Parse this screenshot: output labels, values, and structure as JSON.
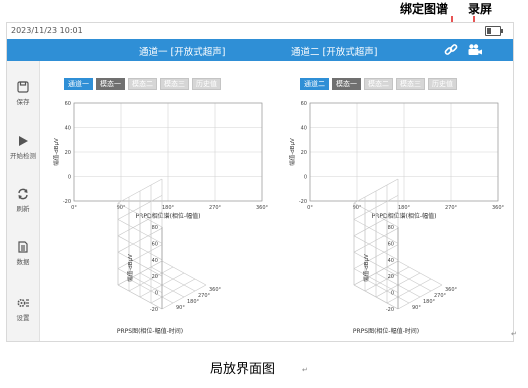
{
  "annotations": {
    "bind_label": "绑定图谱",
    "record_label": "录屏"
  },
  "status": {
    "time": "2023/11/23 10:01"
  },
  "header": {
    "channel1": "通道一 [开放式超声]",
    "channel2": "通道二 [开放式超声]"
  },
  "icons": {
    "bind": "link-icon",
    "record": "camera-icon"
  },
  "sidebar": {
    "items": [
      {
        "label": "保存",
        "icon": "save-icon"
      },
      {
        "label": "开始检测",
        "icon": "play-icon"
      },
      {
        "label": "刷新",
        "icon": "refresh-icon"
      },
      {
        "label": "数据",
        "icon": "data-icon"
      },
      {
        "label": "设置",
        "icon": "settings-icon"
      }
    ]
  },
  "panels": [
    {
      "tabs": [
        "通道一",
        "模态一",
        "模态二",
        "模态三",
        "历史值"
      ],
      "prpd": {
        "ylabel": "幅值-dBμV",
        "xlabel": "PRPD相位谱(相位-幅值)",
        "yticks": [
          "60",
          "40",
          "20",
          "0",
          "-20"
        ],
        "xticks": [
          "0°",
          "90°",
          "180°",
          "270°",
          "360°"
        ]
      },
      "prps": {
        "ylabel": "幅值-dBμV",
        "xlabel": "PRPS图(相位-幅值-时间)",
        "zticks": [
          "80",
          "60",
          "40",
          "20",
          "0",
          "-20"
        ],
        "phase_ticks": [
          "90°",
          "180°",
          "270°",
          "360°"
        ]
      }
    },
    {
      "tabs": [
        "通道二",
        "模态一",
        "模态二",
        "模态三",
        "历史值"
      ],
      "prpd": {
        "ylabel": "幅值-dBμV",
        "xlabel": "PRPD相位谱(相位-幅值)",
        "yticks": [
          "60",
          "40",
          "20",
          "0",
          "-20"
        ],
        "xticks": [
          "0°",
          "90°",
          "180°",
          "270°",
          "360°"
        ]
      },
      "prps": {
        "ylabel": "幅值-dBμV",
        "xlabel": "PRPS图(相位-幅值-时间)",
        "zticks": [
          "80",
          "60",
          "40",
          "20",
          "0",
          "-20"
        ],
        "phase_ticks": [
          "90°",
          "180°",
          "270°",
          "360°"
        ]
      }
    }
  ],
  "colors": {
    "titlebar": "#2f8fd6",
    "active_tab": "#2f8fd6",
    "annotation_arrow": "#e01b1b"
  },
  "caption": "局放界面图"
}
